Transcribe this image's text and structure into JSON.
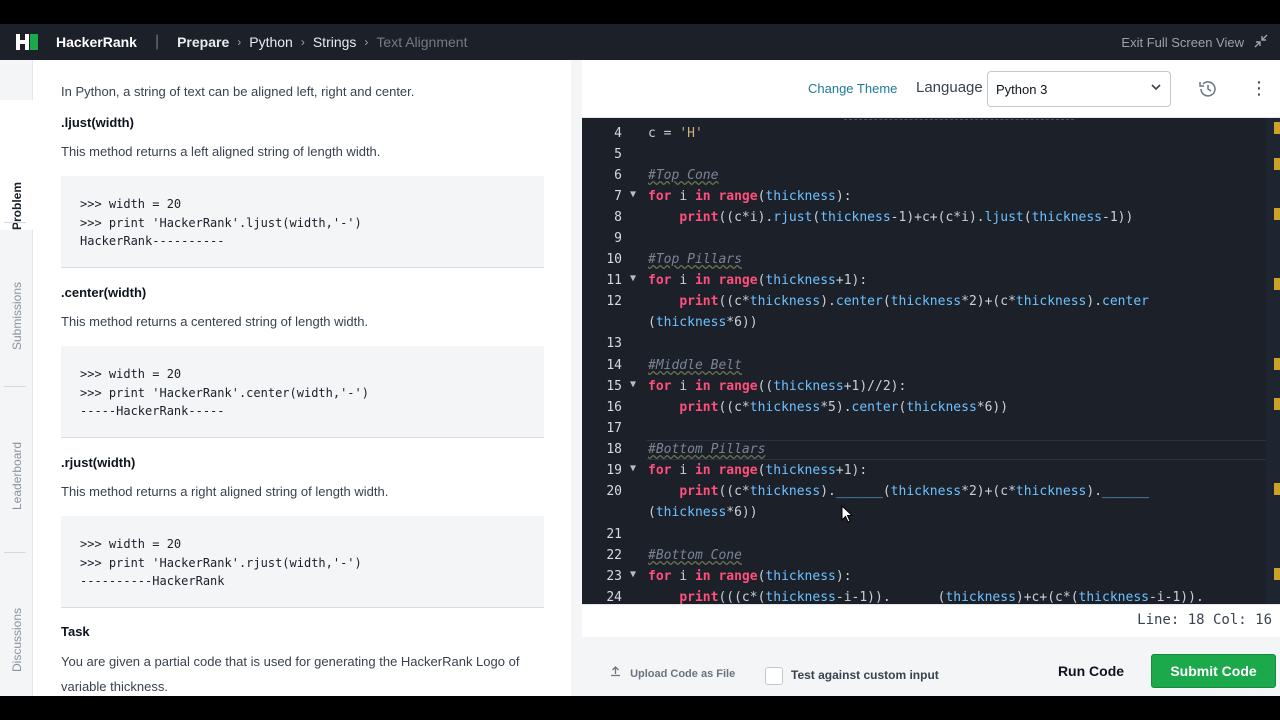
{
  "header": {
    "brand": "HackerRank",
    "breadcrumbs": [
      "Prepare",
      "Python",
      "Strings",
      "Text Alignment"
    ],
    "exit_label": "Exit Full Screen View"
  },
  "sidebar_tabs": [
    "Problem",
    "Submissions",
    "Leaderboard",
    "Discussions"
  ],
  "problem": {
    "intro": "In Python, a string of text can be aligned left, right and center.",
    "methods": [
      {
        "name": ".ljust(width)",
        "desc": "This method returns a left aligned string of length width.",
        "code": ">>> width = 20\n>>> print 'HackerRank'.ljust(width,'-')\nHackerRank----------"
      },
      {
        "name": ".center(width)",
        "desc": "This method returns a centered string of length width.",
        "code": ">>> width = 20\n>>> print 'HackerRank'.center(width,'-')\n-----HackerRank-----"
      },
      {
        "name": ".rjust(width)",
        "desc": "This method returns a right aligned string of length width.",
        "code": ">>> width = 20\n>>> print 'HackerRank'.rjust(width,'-')\n----------HackerRank"
      }
    ],
    "task_title": "Task",
    "task_text_1": "You are given a partial code that is used for generating the HackerRank Logo of",
    "task_text_2": "variable thickness."
  },
  "toolbar": {
    "change_theme": "Change Theme",
    "language_label": "Language",
    "language_value": "Python 3"
  },
  "editor": {
    "line_numbers": [
      "4",
      "5",
      "6",
      "7",
      "8",
      "9",
      "10",
      "11",
      "12",
      "",
      "13",
      "14",
      "15",
      "16",
      "17",
      "18",
      "19",
      "20",
      "",
      "21",
      "22",
      "23",
      "24"
    ]
  },
  "status": {
    "text": "Line: 18 Col: 16"
  },
  "footer": {
    "upload_label": "Upload Code as File",
    "custom_input_label": "Test against custom input",
    "run_label": "Run Code",
    "submit_label": "Submit Code"
  },
  "colors": {
    "accent_green": "#1ba94c",
    "link_teal": "#1a7a9a",
    "editor_bg": "#1b2029"
  }
}
